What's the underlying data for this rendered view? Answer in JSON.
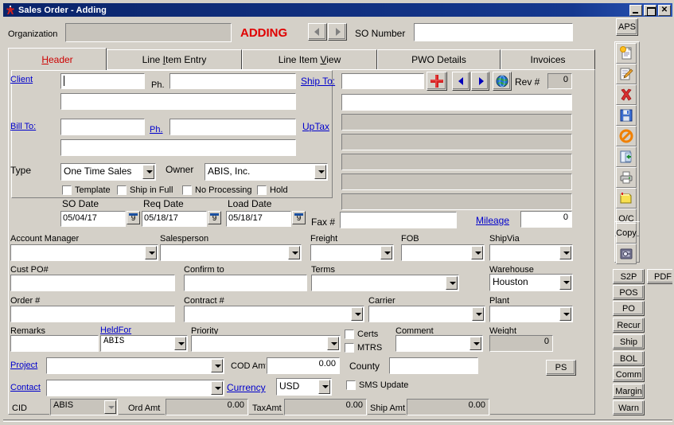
{
  "window": {
    "title": "Sales Order - Adding",
    "app_icon": "app-icon",
    "minimize": "_",
    "maximize": "□",
    "close": "✕"
  },
  "header": {
    "organization_label": "Organization",
    "organization_value": "",
    "status_text": "ADDING",
    "so_number_label": "SO Number",
    "so_number_value": "",
    "prev_label": "◀",
    "next_label": "▶"
  },
  "tabs": [
    {
      "label": "Header",
      "accel": "H",
      "active": true
    },
    {
      "label": "Line Item Entry",
      "accel": "I",
      "active": false
    },
    {
      "label": "Line Item View",
      "accel": "V",
      "active": false
    },
    {
      "label": "PWO Details",
      "accel": "",
      "active": false
    },
    {
      "label": "Invoices",
      "accel": "",
      "active": false
    }
  ],
  "form": {
    "client_label": "Client",
    "client_value": "",
    "client_ph_label": "Ph.",
    "client_ph_value": "",
    "client_addr_value": "",
    "billto_label": "Bill To:",
    "billto_value": "",
    "billto_ph_label": "Ph.",
    "billto_ph_value": "",
    "billto_addr_value": "",
    "type_label": "Type",
    "type_value": "One Time Sales",
    "owner_label": "Owner",
    "owner_value": "ABIS, Inc.",
    "checkboxes": [
      {
        "label": "Template",
        "checked": false
      },
      {
        "label": "Ship in Full",
        "checked": false
      },
      {
        "label": "No Processing",
        "checked": false
      },
      {
        "label": "Hold",
        "checked": false
      }
    ],
    "so_date_label": "SO Date",
    "so_date_value": "05/04/17",
    "req_date_label": "Req Date",
    "req_date_value": "05/18/17",
    "load_date_label": "Load Date",
    "load_date_value": "05/18/17",
    "calendar_glyph": "9",
    "shipto_label": "Ship To:",
    "shipto_value": "",
    "shipto_line1": "",
    "uptax_label": "UpTax",
    "add_label": "+",
    "globe_label": "globe-icon",
    "rev_label": "Rev #",
    "rev_value": "0",
    "fax_label": "Fax #",
    "fax_value": "",
    "mileage_label": "Mileage",
    "mileage_value": "0",
    "account_manager_label": "Account Manager",
    "account_manager_value": "",
    "salesperson_label": "Salesperson",
    "salesperson_value": "",
    "freight_label": "Freight",
    "freight_value": "",
    "fob_label": "FOB",
    "fob_value": "",
    "shipvia_label": "ShipVia",
    "shipvia_value": "",
    "cust_po_label": "Cust PO#",
    "cust_po_value": "",
    "confirm_to_label": "Confirm to",
    "confirm_to_value": "",
    "terms_label": "Terms",
    "terms_value": "",
    "warehouse_label": "Warehouse",
    "warehouse_value": "Houston",
    "order_label": "Order #",
    "order_value": "",
    "contract_label": "Contract #",
    "contract_value": "",
    "carrier_label": "Carrier",
    "carrier_value": "",
    "plant_label": "Plant",
    "plant_value": "",
    "remarks_label": "Remarks",
    "remarks_value": "",
    "heldfor_label": "HeldFor",
    "heldfor_value": "ABIS",
    "priority_label": "Priority",
    "priority_value": "",
    "certs_label": "Certs",
    "mtrs_label": "MTRS",
    "comment_label": "Comment",
    "comment_value": "",
    "weight_label": "Weight",
    "weight_value": "0",
    "project_label": "Project",
    "project_value": "",
    "cod_amt_label": "COD Amt",
    "cod_amt_value": "0.00",
    "county_label": "County",
    "county_value": "",
    "contact_label": "Contact",
    "contact_value": "",
    "currency_label": "Currency",
    "currency_value": "USD",
    "sms_update_label": "SMS Update",
    "ps_label": "PS"
  },
  "statusbar": {
    "cid_label": "CID",
    "cid_value": "ABIS",
    "ord_amt_label": "Ord Amt",
    "ord_amt_value": "0.00",
    "tax_amt_label": "TaxAmt",
    "tax_amt_value": "0.00",
    "ship_amt_label": "Ship Amt",
    "ship_amt_value": "0.00"
  },
  "toolbar": {
    "aps_label": "APS",
    "icons": [
      {
        "name": "new-record-icon",
        "title": "New"
      },
      {
        "name": "edit-record-icon",
        "title": "Edit"
      },
      {
        "name": "delete-record-icon",
        "title": "Delete"
      },
      {
        "name": "save-record-icon",
        "title": "Save"
      },
      {
        "name": "cancel-record-icon",
        "title": "Cancel"
      },
      {
        "name": "exit-icon",
        "title": "Exit"
      },
      {
        "name": "print-icon",
        "title": "Print"
      },
      {
        "name": "notes-icon",
        "title": "Notes"
      }
    ],
    "oc_label": "O/C",
    "copy_label": "Copy",
    "vault_icon": "vault-icon"
  },
  "side_buttons": {
    "s2p": "S2P",
    "pdf": "PDF",
    "pos": "POS",
    "po": "PO",
    "recur": "Recur",
    "ship": "Ship",
    "bol": "BOL",
    "comm": "Comm",
    "margin": "Margin",
    "warn": "Warn"
  },
  "colors": {
    "face": "#d4d0c8",
    "titlebar": "#0a246a",
    "link": "#0000cc",
    "status_red": "#e00000",
    "disabled_field": "#c8c4bc"
  }
}
